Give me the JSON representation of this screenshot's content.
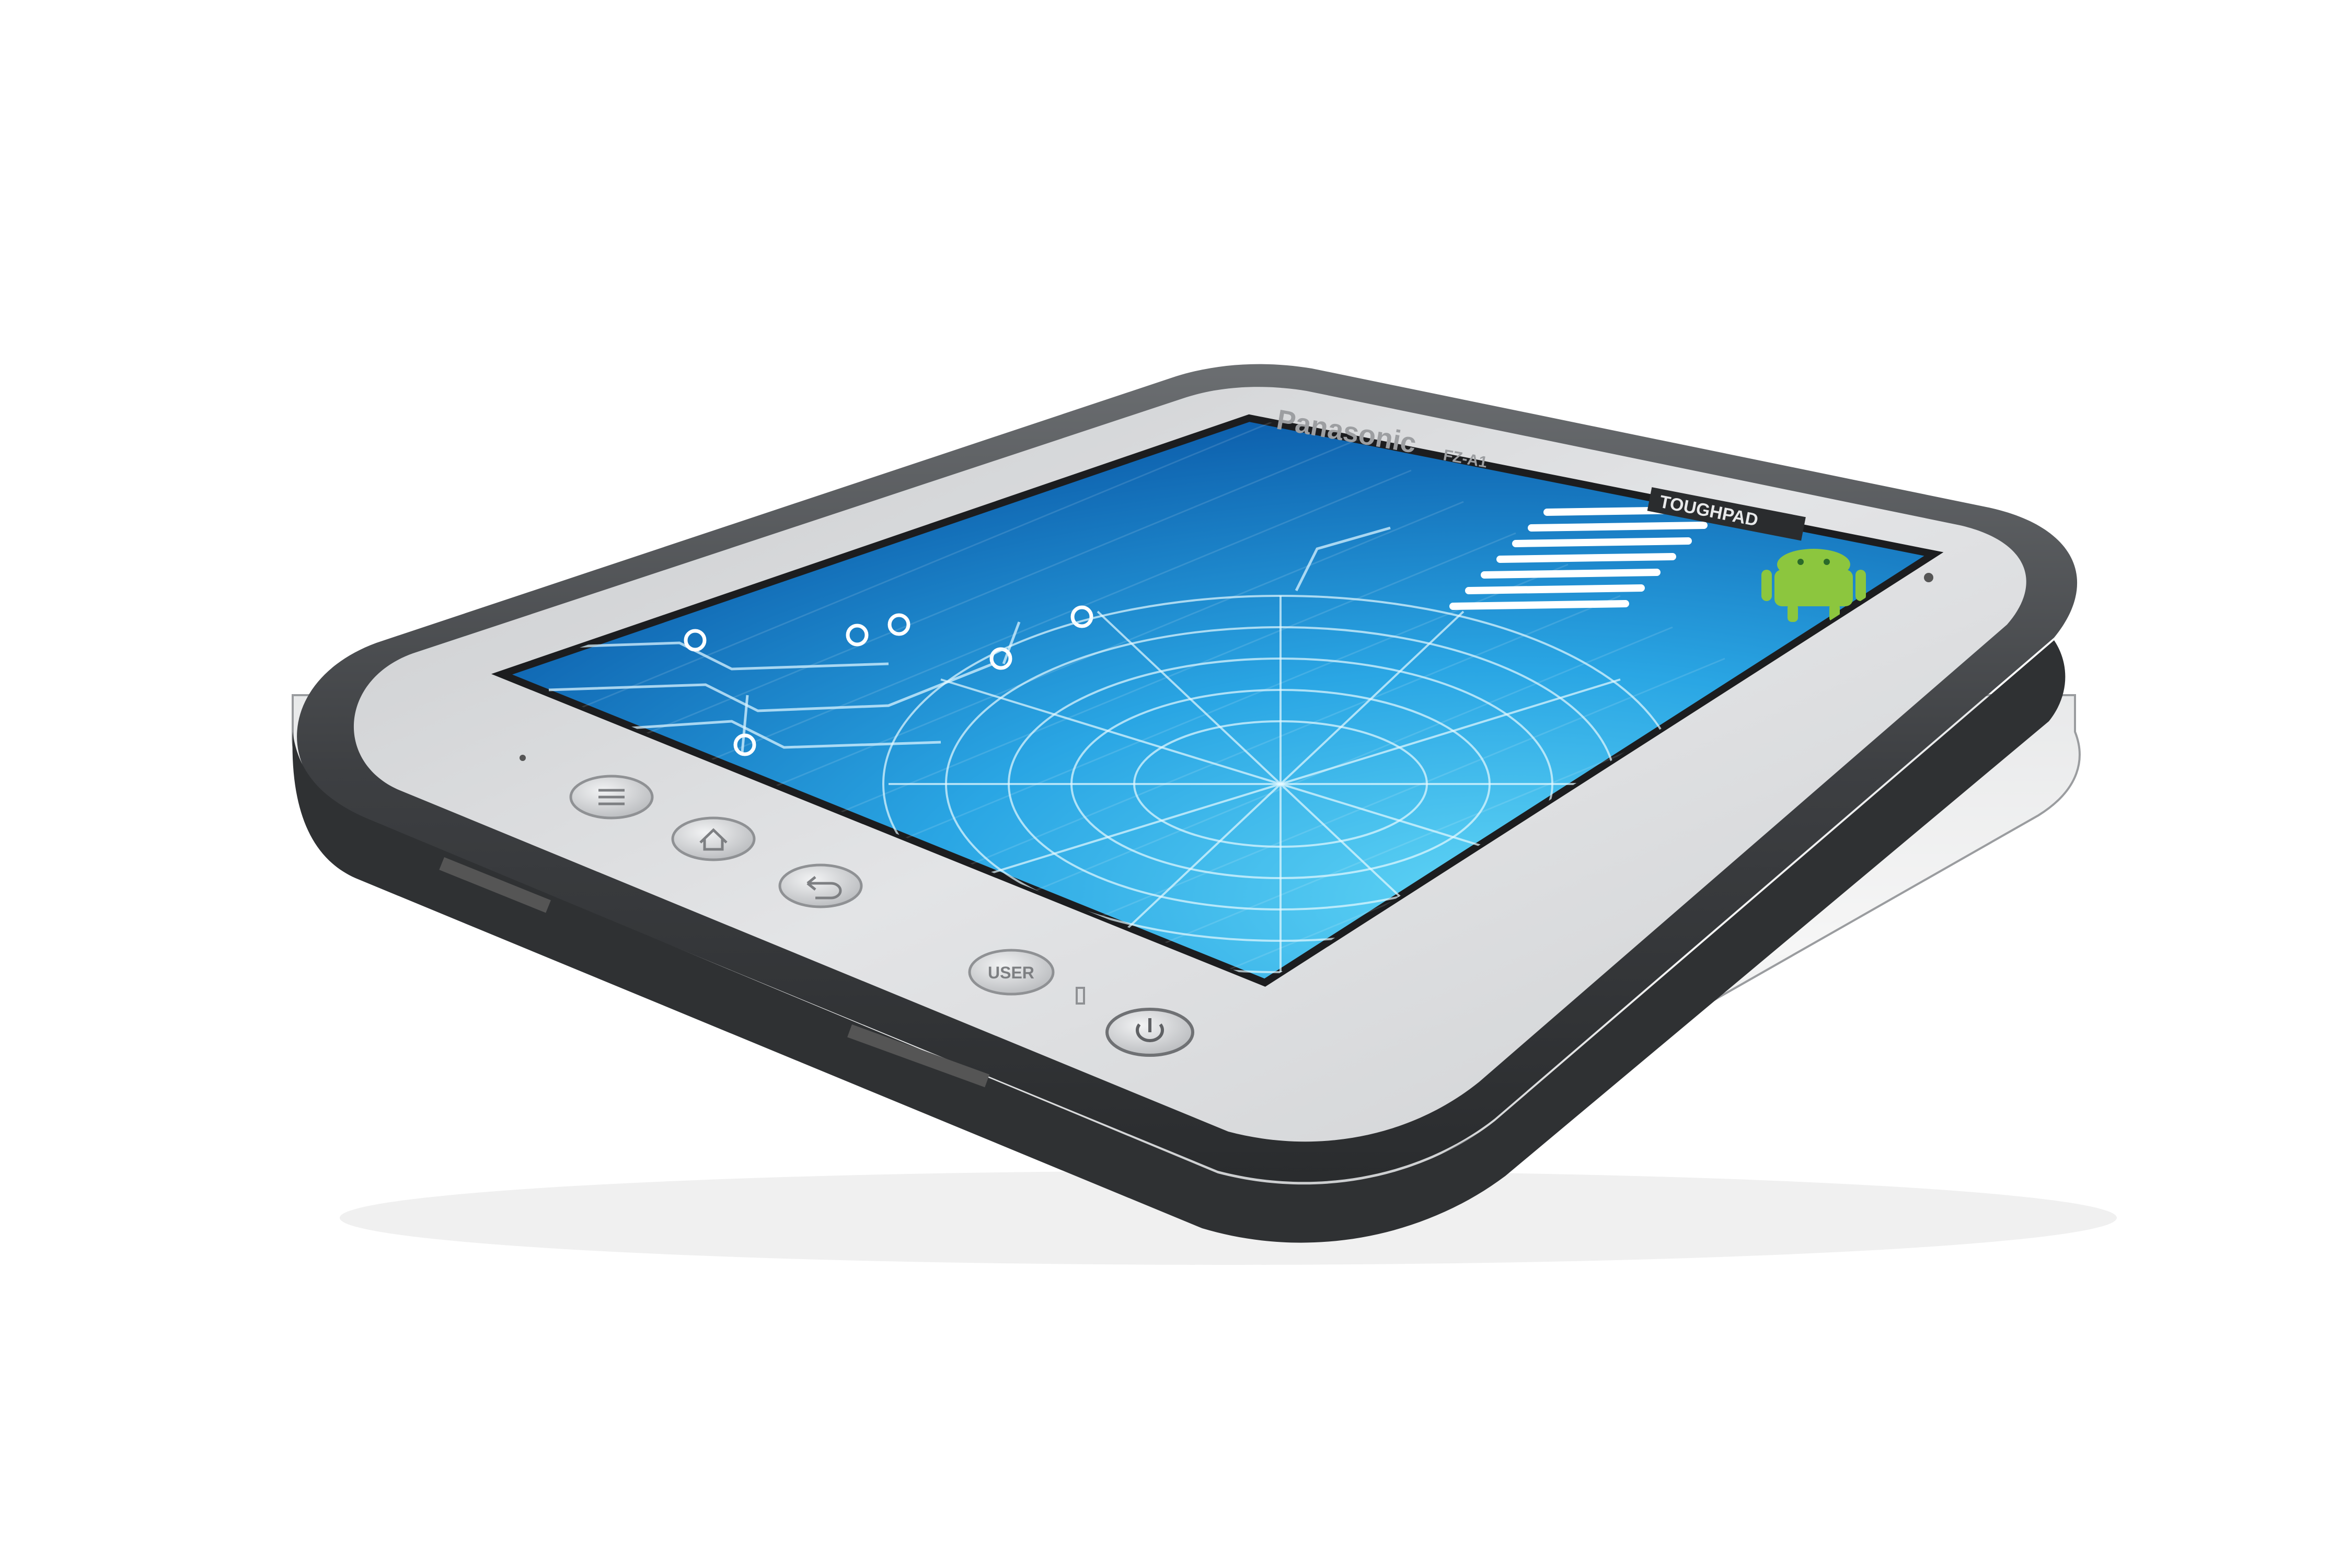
{
  "device": {
    "brand_label": "Panasonic",
    "model_label": "FZ-A1",
    "badge_label": "TOUGHPAD",
    "usr_button_label": "USER"
  },
  "screen": {
    "wallpaper": "blue-circuit-globe",
    "logo": "android-robot-icon"
  },
  "buttons": [
    {
      "name": "menu-button",
      "icon": "menu-icon"
    },
    {
      "name": "home-button",
      "icon": "home-icon"
    },
    {
      "name": "back-button",
      "icon": "back-icon"
    },
    {
      "name": "user-button",
      "icon": "user-icon"
    },
    {
      "name": "power-button",
      "icon": "power-icon"
    }
  ],
  "colors": {
    "bumper": "#4a4c4f",
    "bezel": "#d6d8da",
    "screen_light": "#3fc0f0",
    "screen_dark": "#0a5fb0",
    "android_green": "#8cc63e"
  }
}
